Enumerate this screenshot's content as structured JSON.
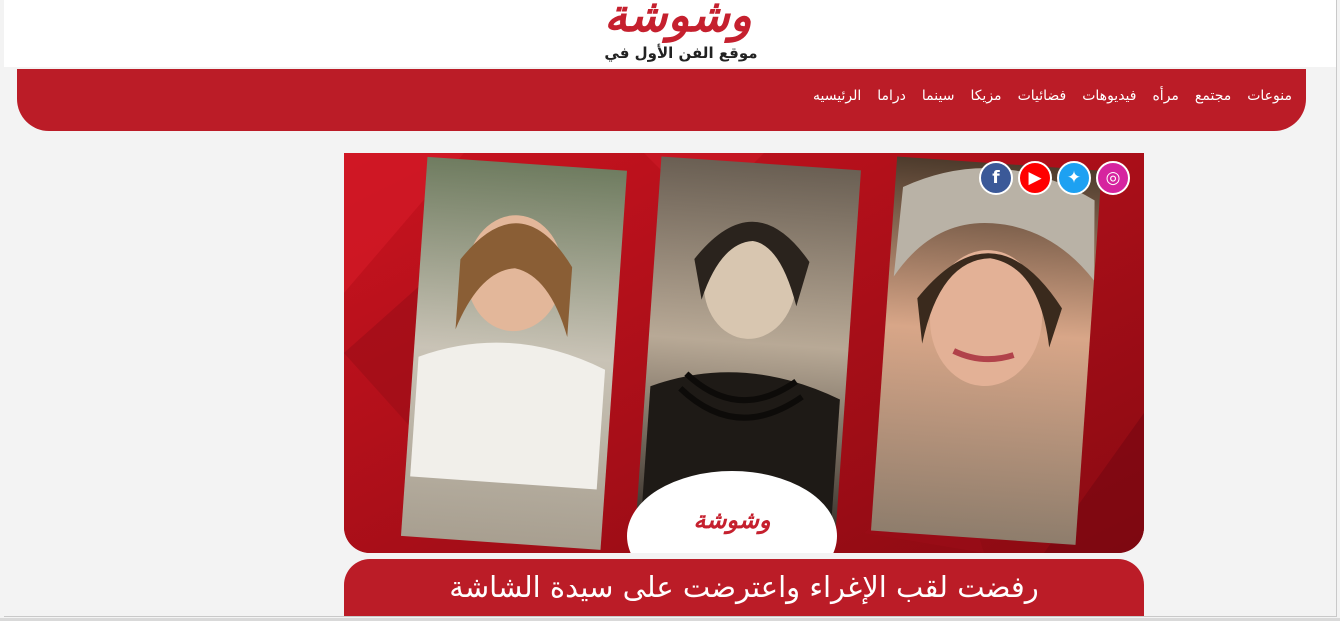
{
  "site": {
    "logo_text": "وشوشة",
    "tagline": "موقع الفن الأول في مصر"
  },
  "nav": {
    "items": [
      {
        "label": "الرئيسيه"
      },
      {
        "label": "دراما"
      },
      {
        "label": "سينما"
      },
      {
        "label": "مزيكا"
      },
      {
        "label": "فضائيات"
      },
      {
        "label": "فيديوهات"
      },
      {
        "label": "مرأه"
      },
      {
        "label": "مجتمع"
      },
      {
        "label": "منوعات"
      }
    ]
  },
  "hero": {
    "watermark": "وشوشة",
    "social": [
      "instagram-icon",
      "twitter-icon",
      "youtube-icon",
      "facebook-icon"
    ]
  },
  "article": {
    "headline": "رفضت لقب الإغراء واعترضت على سيدة الشاشة"
  },
  "colors": {
    "brand_red": "#bb1c27",
    "logo_red": "#c5202e",
    "background": "#f3f3f3"
  }
}
